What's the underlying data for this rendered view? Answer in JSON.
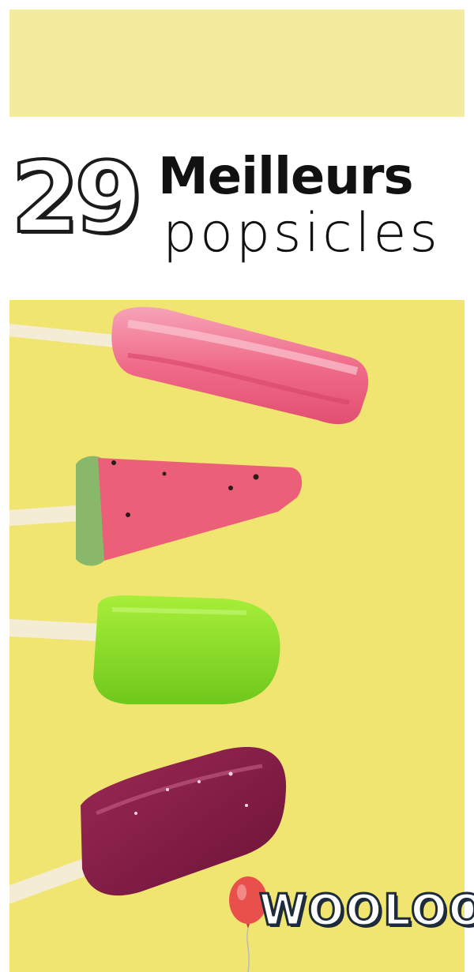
{
  "title": {
    "number": "29",
    "line1": "Meilleurs",
    "line2": "popsicles"
  },
  "brand": {
    "logo_text": "WOOLOO"
  },
  "colors": {
    "background_yellow": "#f1e572",
    "top_band_yellow": "#f3ec9c",
    "twist_pop": "#ee5f7f",
    "watermelon_pop": "#ec5f79",
    "watermelon_rind": "#8ab86a",
    "lime_pop": "#8fe02a",
    "berry_pop": "#8a1c45",
    "balloon": "#e9504c"
  },
  "icons": [
    "balloon-icon"
  ]
}
